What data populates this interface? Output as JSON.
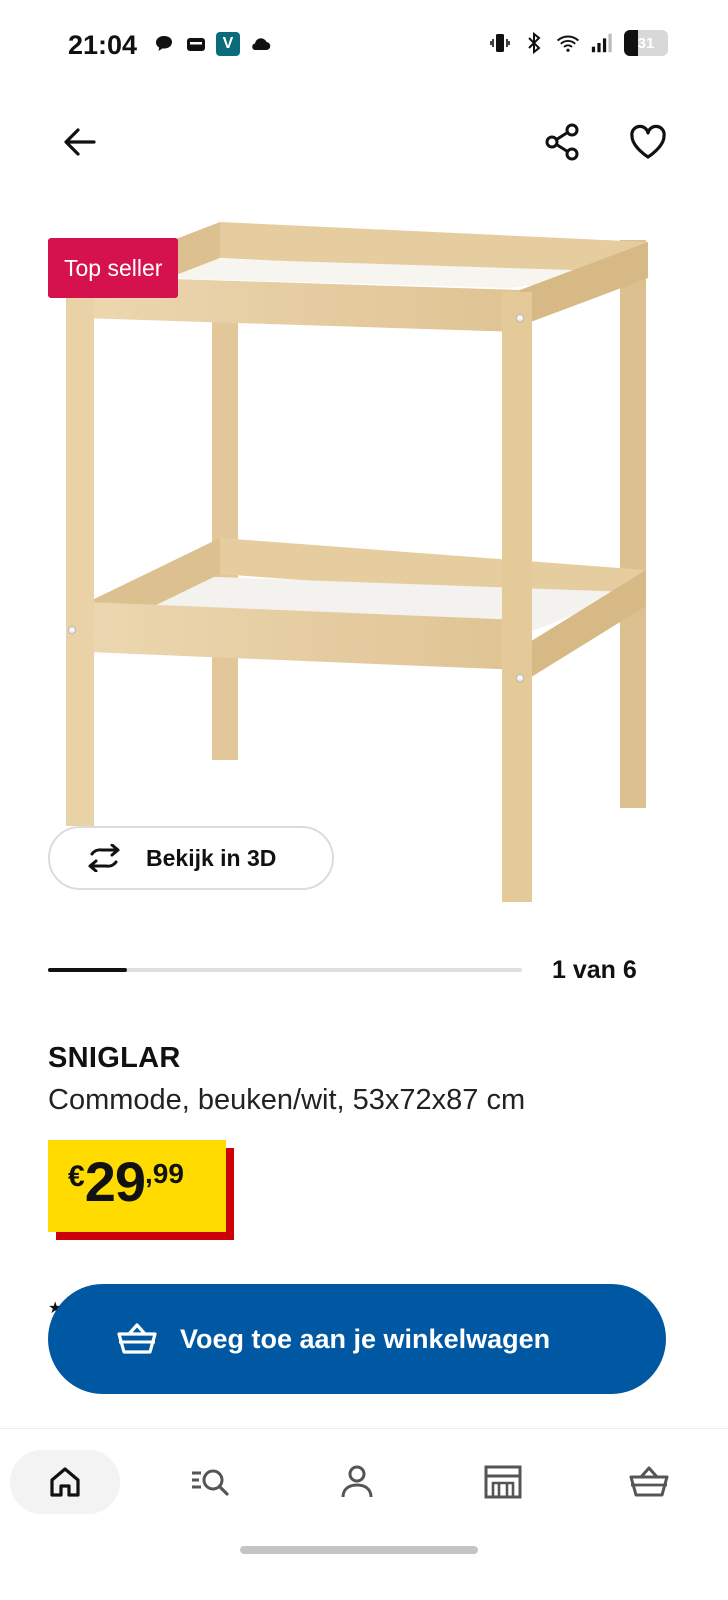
{
  "status_bar": {
    "time": "21:04",
    "left_icons": [
      "chat-icon",
      "wallet-icon",
      "v-app-icon",
      "cloud-icon"
    ],
    "v_badge": "V",
    "right_icons": [
      "vibrate-icon",
      "bluetooth-icon",
      "wifi-icon",
      "signal-icon",
      "battery-icon"
    ],
    "battery_level": "31",
    "battery_fraction": 0.31
  },
  "header": {
    "back_icon": "arrow-left-icon",
    "share_icon": "share-icon",
    "favorite_icon": "heart-icon"
  },
  "gallery": {
    "badge": "Top seller",
    "view_3d_label": "Bekijk in 3D",
    "view_3d_icon": "rotate-3d-icon",
    "counter": "1 van 6",
    "progress_fraction": 0.1667
  },
  "product": {
    "name": "SNIGLAR",
    "description": "Commode, beuken/wit, 53x72x87 cm",
    "price_currency": "€",
    "price_integer": "29",
    "price_decimal": ",99"
  },
  "cart_button": {
    "label": "Voeg toe aan je winkelwagen",
    "icon": "basket-icon"
  },
  "bottom_nav": {
    "items": [
      {
        "name": "home",
        "icon": "home-icon",
        "active": true
      },
      {
        "name": "search",
        "icon": "search-list-icon",
        "active": false
      },
      {
        "name": "profile",
        "icon": "person-icon",
        "active": false
      },
      {
        "name": "stores",
        "icon": "store-icon",
        "active": false
      },
      {
        "name": "cart",
        "icon": "basket-icon",
        "active": false
      }
    ]
  },
  "colors": {
    "badge": "#d6124e",
    "price_background": "#ffdb00",
    "price_shadow": "#cc0008",
    "primary_button": "#0058a3",
    "wood": "#e8cfa4"
  }
}
